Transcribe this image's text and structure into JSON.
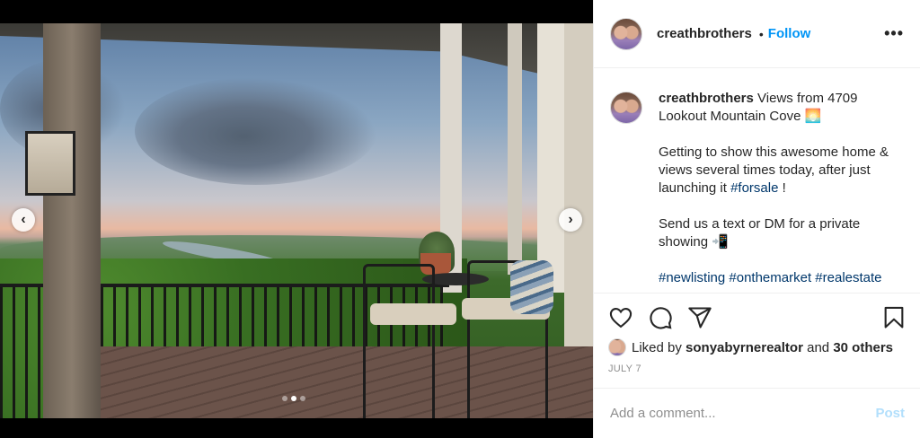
{
  "post": {
    "username": "creathbrothers",
    "separator": "•",
    "follow_label": "Follow",
    "more_label": "•••"
  },
  "caption": {
    "username": "creathbrothers",
    "line1": "Views from 4709 Lookout Mountain Cove 🌅",
    "para2_before": "Getting to show this awesome home & views several times today, after just launching it ",
    "para2_tag": "#forsale",
    "para2_after": " !",
    "para3": "Send us a text or DM for a private showing 📲",
    "hashtags": [
      "#newlisting",
      "#onthemarket",
      "#realestate"
    ]
  },
  "carousel": {
    "prev_icon": "‹",
    "next_icon": "›",
    "slide_count": 3,
    "active_slide": 2
  },
  "likes": {
    "prefix": "Liked by",
    "user": "sonyabyrnerealtor",
    "middle": "and",
    "others": "30 others"
  },
  "date": "JULY 7",
  "comment": {
    "placeholder": "Add a comment...",
    "post_label": "Post"
  },
  "colors": {
    "accent": "#0095f6",
    "post_disabled": "#b2dffc",
    "text": "#262626",
    "muted": "#8e8e8e",
    "link": "#00376b"
  },
  "icons": {
    "like": "heart-icon",
    "comment": "comment-bubble-icon",
    "share": "paper-plane-icon",
    "save": "bookmark-icon",
    "more": "ellipsis-icon"
  }
}
